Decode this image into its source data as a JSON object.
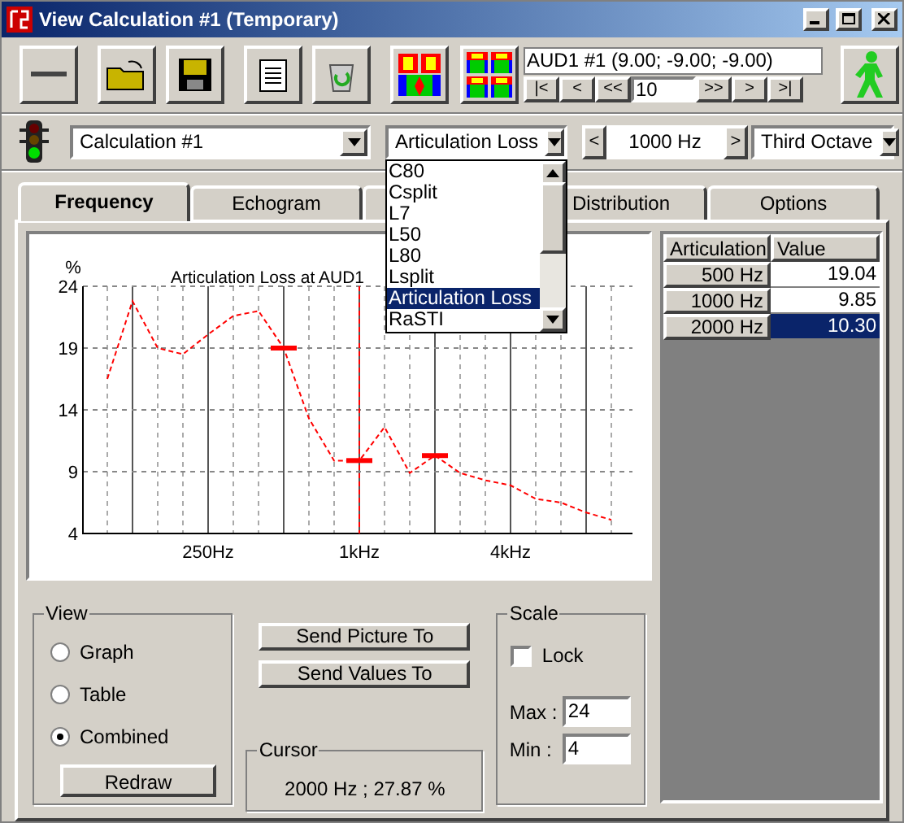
{
  "window": {
    "title": "View Calculation #1 (Temporary)"
  },
  "receiver": {
    "label": "AUD1 #1  (9.00; -9.00; -9.00)",
    "step": "10",
    "nav_left": [
      "|<",
      "<",
      "<<"
    ],
    "nav_right": [
      ">>",
      ">",
      ">|"
    ]
  },
  "selectors": {
    "calculation": "Calculation #1",
    "parameter": "Articulation Loss",
    "prev": "<",
    "frequency": "1000 Hz",
    "next": ">",
    "band": "Third Octave"
  },
  "parameter_list": [
    {
      "label": "C80",
      "selected": false
    },
    {
      "label": "Csplit",
      "selected": false
    },
    {
      "label": "L7",
      "selected": false
    },
    {
      "label": "L50",
      "selected": false
    },
    {
      "label": "L80",
      "selected": false
    },
    {
      "label": "Lsplit",
      "selected": false
    },
    {
      "label": "Articulation Loss",
      "selected": true
    },
    {
      "label": "RaSTI",
      "selected": false
    }
  ],
  "tabs": [
    {
      "label": "Frequency",
      "selected": true
    },
    {
      "label": "Echogram",
      "selected": false
    },
    {
      "selected": false
    },
    {
      "label": "Distribution",
      "selected": false
    },
    {
      "label": "Options",
      "selected": false
    }
  ],
  "chart": {
    "chart_data": {
      "type": "line",
      "title": "Articulation Loss at AUD1",
      "ylabel": "%",
      "categories": [
        null,
        null,
        null,
        null,
        "250Hz",
        null,
        null,
        null,
        null,
        null,
        "1kHz",
        null,
        null,
        null,
        null,
        null,
        "4kHz",
        null,
        null,
        null,
        null
      ],
      "grid": true,
      "series": [
        {
          "color": "#ff0000",
          "line_style": "dashed",
          "values": [
            16.5,
            22.8,
            19.0,
            18.5,
            20.1,
            21.6,
            22.0,
            19.0,
            13.3,
            9.9,
            9.9,
            12.6,
            8.9,
            10.3,
            8.9,
            8.3,
            7.9,
            6.8,
            6.5,
            5.7,
            5.1
          ]
        }
      ],
      "ylim": [
        4,
        24
      ],
      "yticks": [
        4,
        9,
        14,
        19,
        24
      ],
      "ref_lines": [
        {
          "axis": "x",
          "value": "1kHz"
        }
      ]
    }
  },
  "table": {
    "columns": [
      "Articulation",
      "Value"
    ],
    "rows": [
      {
        "label": "500 Hz",
        "value": "19.04",
        "selected": false
      },
      {
        "label": "1000 Hz",
        "value": "9.85",
        "selected": false
      },
      {
        "label": "2000 Hz",
        "value": "10.30",
        "selected": true
      }
    ]
  },
  "view": {
    "title": "View",
    "options": [
      {
        "label": "Graph",
        "selected": false
      },
      {
        "label": "Table",
        "selected": false
      },
      {
        "label": "Combined",
        "selected": true
      }
    ],
    "redraw": "Redraw"
  },
  "send": [
    "Send Picture To",
    "Send Values To"
  ],
  "cursor": {
    "title": "Cursor",
    "reading": "2000 Hz ; 27.87 %"
  },
  "scale": {
    "title": "Scale",
    "lock": {
      "label": "Lock",
      "checked": false
    },
    "max_label": "Max :",
    "max": "24",
    "min_label": "Min :",
    "min": "4"
  }
}
